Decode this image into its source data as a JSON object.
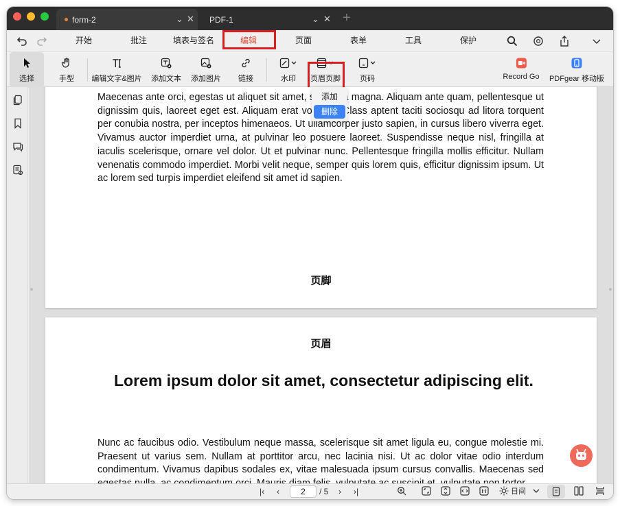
{
  "tabs": [
    {
      "label": "form-2",
      "active": true
    },
    {
      "label": "PDF-1",
      "active": false
    }
  ],
  "menu": {
    "items": [
      "开始",
      "批注",
      "填表与签名",
      "编辑",
      "页面",
      "表单",
      "工具",
      "保护"
    ],
    "active": "编辑"
  },
  "toolbar": {
    "select": "选择",
    "hand": "手型",
    "edit_text_image": "编辑文字&图片",
    "add_text": "添加文本",
    "add_image": "添加图片",
    "link": "链接",
    "watermark": "水印",
    "header_footer": "页眉页脚",
    "page_number": "页码",
    "record_go": "Record Go",
    "pdfgear_mobile": "PDFgear 移动版"
  },
  "dropdown": {
    "add": "添加",
    "delete": "删除"
  },
  "document": {
    "page1_paragraph": "Maecenas ante orci, egestas ut aliquet sit amet, sagittis a magna. Aliquam ante quam, pellentesque ut dignissim quis, laoreet eget est. Aliquam erat volutpat. Class aptent taciti sociosqu ad litora torquent per conubia nostra, per inceptos himenaeos. Ut ullamcorper justo sapien, in cursus libero viverra eget. Vivamus auctor imperdiet urna, at pulvinar leo posuere laoreet. Suspendisse neque nisl, fringilla at iaculis scelerisque, ornare vel dolor. Ut et pulvinar nunc. Pellentesque fringilla mollis efficitur. Nullam venenatis commodo imperdiet. Morbi velit neque, semper quis lorem quis, efficitur dignissim ipsum. Ut ac lorem sed turpis imperdiet eleifend sit amet id sapien.",
    "page1_footer": "页脚",
    "page2_header": "页眉",
    "page2_heading": "Lorem ipsum dolor sit amet, consectetur adipiscing elit.",
    "page2_paragraph": "Nunc ac faucibus odio. Vestibulum neque massa, scelerisque sit amet ligula eu, congue molestie mi. Praesent ut varius sem. Nullam at porttitor arcu, nec lacinia nisi. Ut ac dolor vitae odio interdum condimentum. Vivamus dapibus sodales ex, vitae malesuada ipsum cursus convallis. Maecenas sed egestas nulla, ac condimentum orci. Mauris diam felis, vulputate ac suscipit et, vulputate non tortor."
  },
  "statusbar": {
    "current_page": "2",
    "total_pages": "/ 5",
    "view_mode": "日间"
  },
  "colors": {
    "accent_red": "#e24d3b",
    "highlight_box": "#d81f1f",
    "dropdown_hover": "#3b82f6",
    "record_go": "#ef5a4a",
    "pdfgear_blue": "#3b82f6"
  }
}
